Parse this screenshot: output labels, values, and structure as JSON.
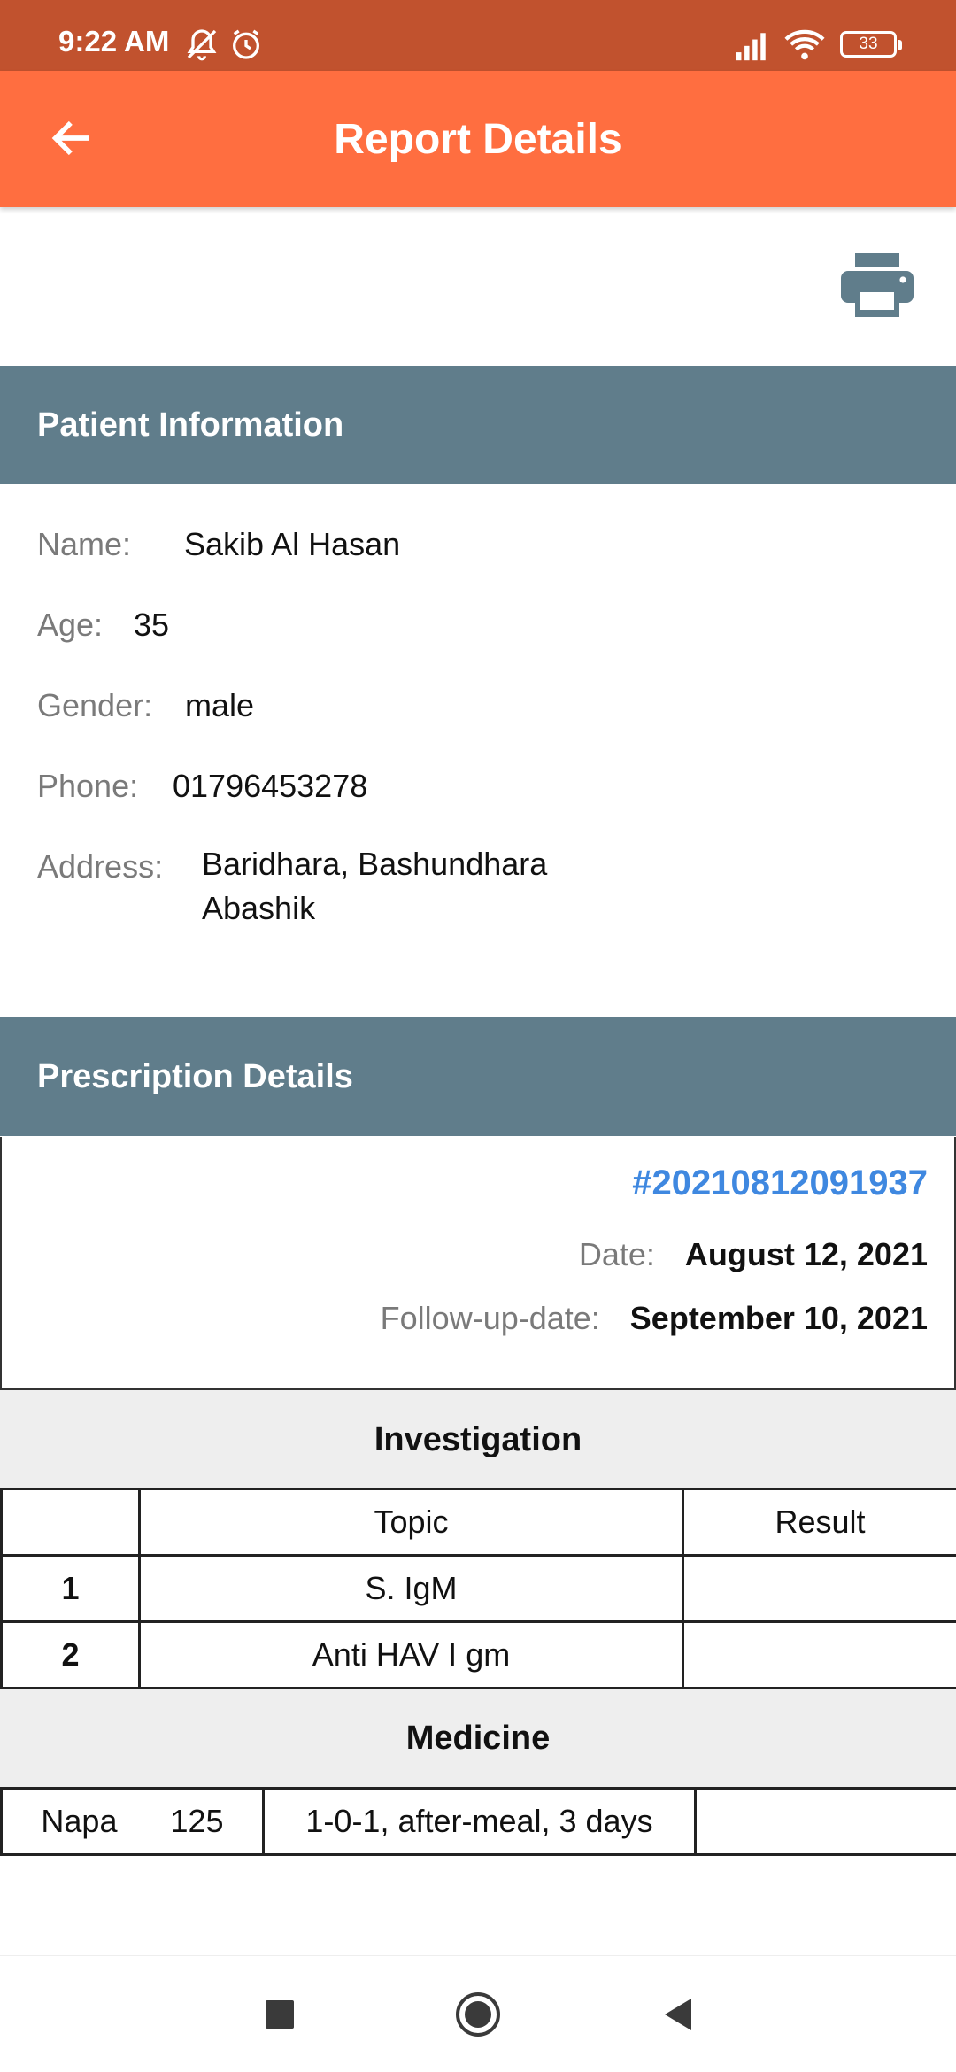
{
  "status_bar": {
    "time": "9:22 AM",
    "battery": "33",
    "icons": [
      "mute-icon",
      "alarm-icon",
      "signal-icon",
      "wifi-icon",
      "battery-icon"
    ]
  },
  "app_bar": {
    "title": "Report Details",
    "back_icon": "arrow-back-icon",
    "color": "#ff6e40"
  },
  "print_icon": "printer-icon",
  "patient": {
    "header": "Patient Information",
    "name_label": "Name:",
    "name": "Sakib Al Hasan",
    "age_label": "Age:",
    "age": "35",
    "gender_label": "Gender:",
    "gender": "male",
    "phone_label": "Phone:",
    "phone": "01796453278",
    "address_label": "Address:",
    "address_line1": "Baridhara, Bashundhara",
    "address_line2": "Abashik"
  },
  "prescription": {
    "header": "Prescription Details",
    "id": "#20210812091937",
    "date_label": "Date:",
    "date": "August 12, 2021",
    "followup_label": "Follow-up-date:",
    "followup": "September 10, 2021"
  },
  "investigation": {
    "title": "Investigation",
    "columns": [
      "",
      "Topic",
      "Result"
    ],
    "rows": [
      {
        "no": "1",
        "topic": "S. IgM",
        "result": ""
      },
      {
        "no": "2",
        "topic": "Anti HAV I gm",
        "result": ""
      }
    ]
  },
  "medicine": {
    "title": "Medicine",
    "rows": [
      {
        "name": "Napa",
        "strength": "125",
        "dosage": "1-0-1, after-meal, 3 days",
        "note": ""
      }
    ]
  },
  "nav": {
    "icons": [
      "recent-apps-icon",
      "home-icon",
      "back-icon"
    ]
  }
}
